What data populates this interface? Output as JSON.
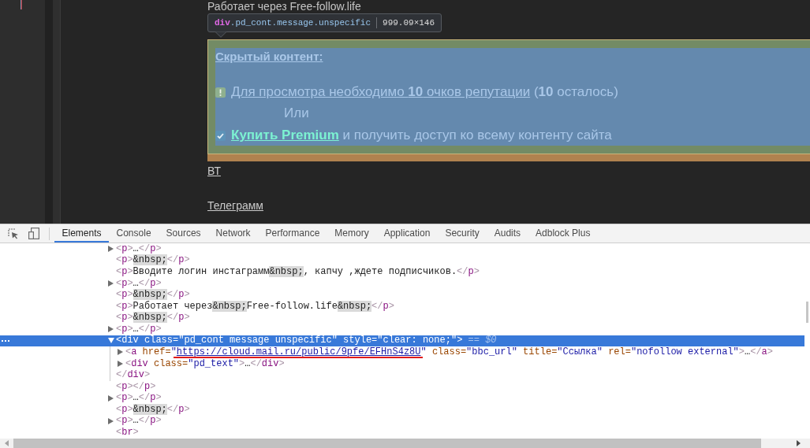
{
  "page": {
    "intro": "Работает через Free-follow.life",
    "inspect_tooltip": {
      "tag": "div",
      "selector": ".pd_cont.message.unspecific",
      "size": "999.09×146"
    },
    "hidden_content": {
      "title": "Скрытый контент:",
      "requirement": {
        "link": "Для просмотра необходимо **10** очков репутации",
        "remainder": "(**10** осталось)"
      },
      "separator": "Или",
      "premium": {
        "link": "Купить Premium",
        "remainder": "и получить доступ ко всему контенту сайта"
      }
    },
    "links": [
      "ВТ",
      "Телеграмм"
    ]
  },
  "devtools": {
    "tabs": [
      {
        "label": "Elements",
        "selected": true
      },
      {
        "label": "Console",
        "selected": false
      },
      {
        "label": "Sources",
        "selected": false
      },
      {
        "label": "Network",
        "selected": false
      },
      {
        "label": "Performance",
        "selected": false
      },
      {
        "label": "Memory",
        "selected": false
      },
      {
        "label": "Application",
        "selected": false
      },
      {
        "label": "Security",
        "selected": false
      },
      {
        "label": "Audits",
        "selected": false
      },
      {
        "label": "Adblock Plus",
        "selected": false
      }
    ],
    "dom_tree": [
      {
        "kind": "element",
        "expanded": false,
        "selected": false,
        "tokens": [
          {
            "kind": "tag",
            "text": "<p>"
          },
          {
            "kind": "text",
            "text": "…"
          },
          {
            "kind": "tag",
            "text": "</p>"
          }
        ]
      },
      {
        "kind": "leaf",
        "selected": false,
        "tokens": [
          {
            "kind": "tag",
            "text": "<p>"
          },
          {
            "kind": "entity",
            "text": "&nbsp;"
          },
          {
            "kind": "tag",
            "text": "</p>"
          }
        ]
      },
      {
        "kind": "leaf",
        "selected": false,
        "tokens": [
          {
            "kind": "tag",
            "text": "<p>"
          },
          {
            "kind": "text",
            "text": "Вводите логин инстаграмм"
          },
          {
            "kind": "entity",
            "text": "&nbsp;"
          },
          {
            "kind": "text",
            "text": ", капчу ,ждете подписчиков."
          },
          {
            "kind": "tag",
            "text": "</p>"
          }
        ]
      },
      {
        "kind": "element",
        "expanded": false,
        "selected": false,
        "tokens": [
          {
            "kind": "tag",
            "text": "<p>"
          },
          {
            "kind": "text",
            "text": "…"
          },
          {
            "kind": "tag",
            "text": "</p>"
          }
        ]
      },
      {
        "kind": "leaf",
        "selected": false,
        "tokens": [
          {
            "kind": "tag",
            "text": "<p>"
          },
          {
            "kind": "entity",
            "text": "&nbsp;"
          },
          {
            "kind": "tag",
            "text": "</p>"
          }
        ]
      },
      {
        "kind": "leaf",
        "selected": false,
        "tokens": [
          {
            "kind": "tag",
            "text": "<p>"
          },
          {
            "kind": "text",
            "text": "Работает через"
          },
          {
            "kind": "entity",
            "text": "&nbsp;"
          },
          {
            "kind": "text",
            "text": "Free-follow.life"
          },
          {
            "kind": "entity",
            "text": "&nbsp;"
          },
          {
            "kind": "tag",
            "text": "</p>"
          }
        ]
      },
      {
        "kind": "leaf",
        "selected": false,
        "tokens": [
          {
            "kind": "tag",
            "text": "<p>"
          },
          {
            "kind": "entity",
            "text": "&nbsp;"
          },
          {
            "kind": "tag",
            "text": "</p>"
          }
        ]
      },
      {
        "kind": "element",
        "expanded": false,
        "selected": false,
        "tokens": [
          {
            "kind": "tag",
            "text": "<p>"
          },
          {
            "kind": "text",
            "text": "…"
          },
          {
            "kind": "tag",
            "text": "</p>"
          }
        ]
      },
      {
        "kind": "element",
        "expanded": true,
        "selected": true,
        "tokens": [
          {
            "kind": "tag",
            "text": "<div"
          },
          {
            "kind": "attr",
            "text": " class="
          },
          {
            "kind": "value",
            "text": "\"pd_cont message unspecific\""
          },
          {
            "kind": "attr",
            "text": " style="
          },
          {
            "kind": "value",
            "text": "\"clear: none;\""
          },
          {
            "kind": "tag",
            "text": ">"
          },
          {
            "kind": "ref",
            "text": " == $0"
          }
        ],
        "children": [
          {
            "kind": "element",
            "expanded": false,
            "selected": false,
            "tokens": [
              {
                "kind": "tag",
                "text": "<a"
              },
              {
                "kind": "attr",
                "text": " href="
              },
              {
                "kind": "value",
                "text": "\""
              },
              {
                "kind": "link",
                "text": "https://cloud.mail.ru/public/9pfe/EFHnS4z8U",
                "annotated": true
              },
              {
                "kind": "value",
                "text": "\""
              },
              {
                "kind": "attr",
                "text": " class="
              },
              {
                "kind": "value",
                "text": "\"bbc_url\""
              },
              {
                "kind": "attr",
                "text": " title="
              },
              {
                "kind": "value",
                "text": "\"Ссылка\""
              },
              {
                "kind": "attr",
                "text": " rel="
              },
              {
                "kind": "value",
                "text": "\"nofollow external\""
              },
              {
                "kind": "tag",
                "text": ">"
              },
              {
                "kind": "text",
                "text": "…"
              },
              {
                "kind": "tag",
                "text": "</a>"
              }
            ]
          },
          {
            "kind": "element",
            "expanded": false,
            "selected": false,
            "tokens": [
              {
                "kind": "tag",
                "text": "<div"
              },
              {
                "kind": "attr",
                "text": " class="
              },
              {
                "kind": "value",
                "text": "\"pd_text\""
              },
              {
                "kind": "tag",
                "text": ">"
              },
              {
                "kind": "text",
                "text": "…"
              },
              {
                "kind": "tag",
                "text": "</div>"
              }
            ]
          }
        ],
        "closing": [
          {
            "kind": "tag",
            "text": "</div>"
          }
        ]
      },
      {
        "kind": "leaf",
        "selected": false,
        "tokens": [
          {
            "kind": "tag",
            "text": "<p></p>"
          }
        ]
      },
      {
        "kind": "element",
        "expanded": false,
        "selected": false,
        "tokens": [
          {
            "kind": "tag",
            "text": "<p>"
          },
          {
            "kind": "text",
            "text": "…"
          },
          {
            "kind": "tag",
            "text": "</p>"
          }
        ]
      },
      {
        "kind": "leaf",
        "selected": false,
        "tokens": [
          {
            "kind": "tag",
            "text": "<p>"
          },
          {
            "kind": "entity",
            "text": "&nbsp;"
          },
          {
            "kind": "tag",
            "text": "</p>"
          }
        ]
      },
      {
        "kind": "element",
        "expanded": false,
        "selected": false,
        "tokens": [
          {
            "kind": "tag",
            "text": "<p>"
          },
          {
            "kind": "text",
            "text": "…"
          },
          {
            "kind": "tag",
            "text": "</p>"
          }
        ]
      },
      {
        "kind": "leaf",
        "selected": false,
        "tokens": [
          {
            "kind": "tag",
            "text": "<br>"
          }
        ]
      }
    ]
  }
}
